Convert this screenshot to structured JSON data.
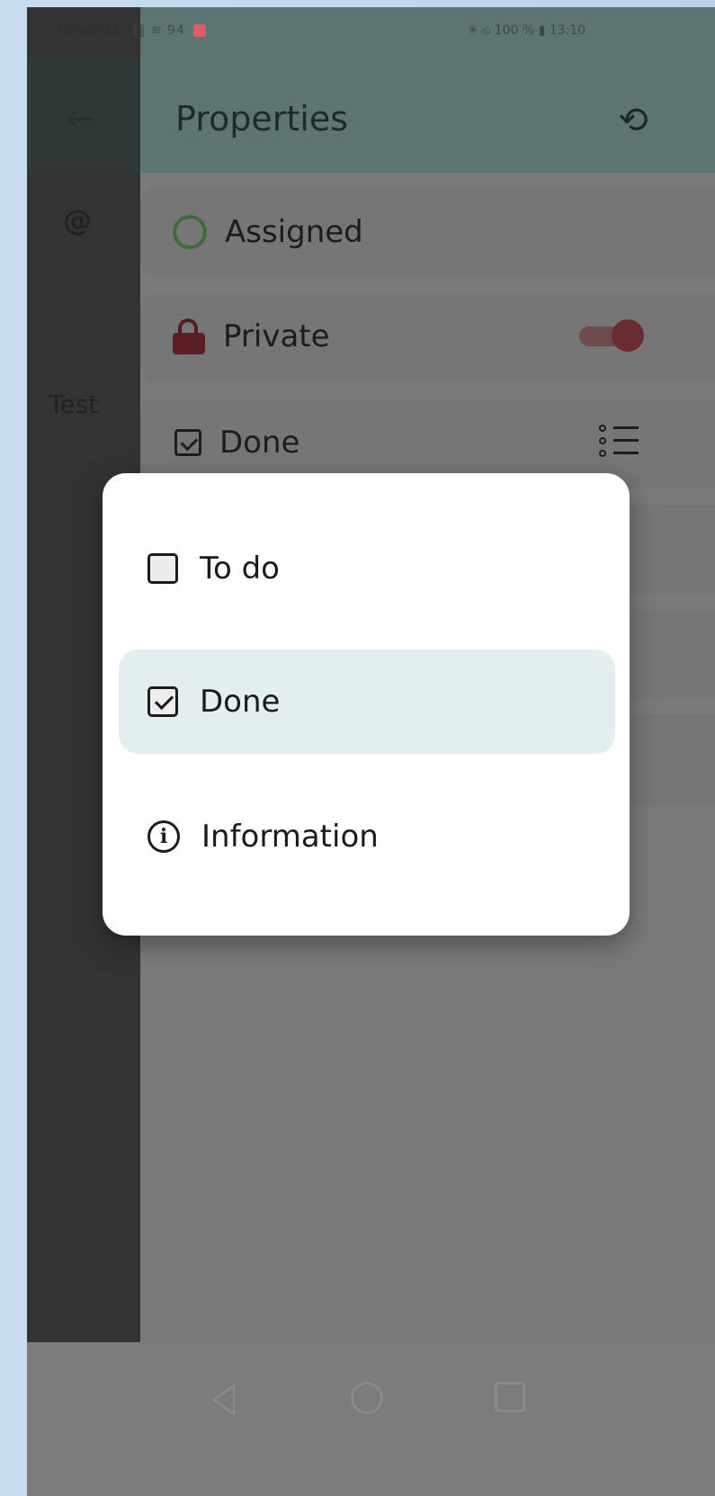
{
  "status_bar": {
    "carrier": "HONVOZ",
    "signal_text": "∥∥ ≋ 94",
    "right_text": "✳ ⦸ 100 % ▮ 13:10"
  },
  "app_bar": {
    "title": "Properties",
    "back_icon": "←",
    "history_icon": "⟲"
  },
  "drawer": {
    "at_icon": "@",
    "item_label": "Test"
  },
  "properties": [
    {
      "label": "Assigned",
      "icon": "ring-icon"
    },
    {
      "label": "Private",
      "icon": "lock-icon",
      "toggle_on": true
    },
    {
      "label": "Done",
      "icon": "checkbox-checked-icon",
      "trailing": "list-icon"
    }
  ],
  "dialog": {
    "options": [
      {
        "label": "To do",
        "icon": "checkbox-empty-icon",
        "selected": false
      },
      {
        "label": "Done",
        "icon": "checkbox-checked-icon",
        "selected": true
      },
      {
        "label": "Information",
        "icon": "info-icon",
        "selected": false
      }
    ]
  },
  "colors": {
    "scrim": "#7a7a7a",
    "dialog_bg": "#ffffff",
    "selected_option_bg": "#e3eef0",
    "app_bar": "#5e7473",
    "private_toggle": "#6a2b31",
    "assigned_ring": "#3f6a3b"
  }
}
